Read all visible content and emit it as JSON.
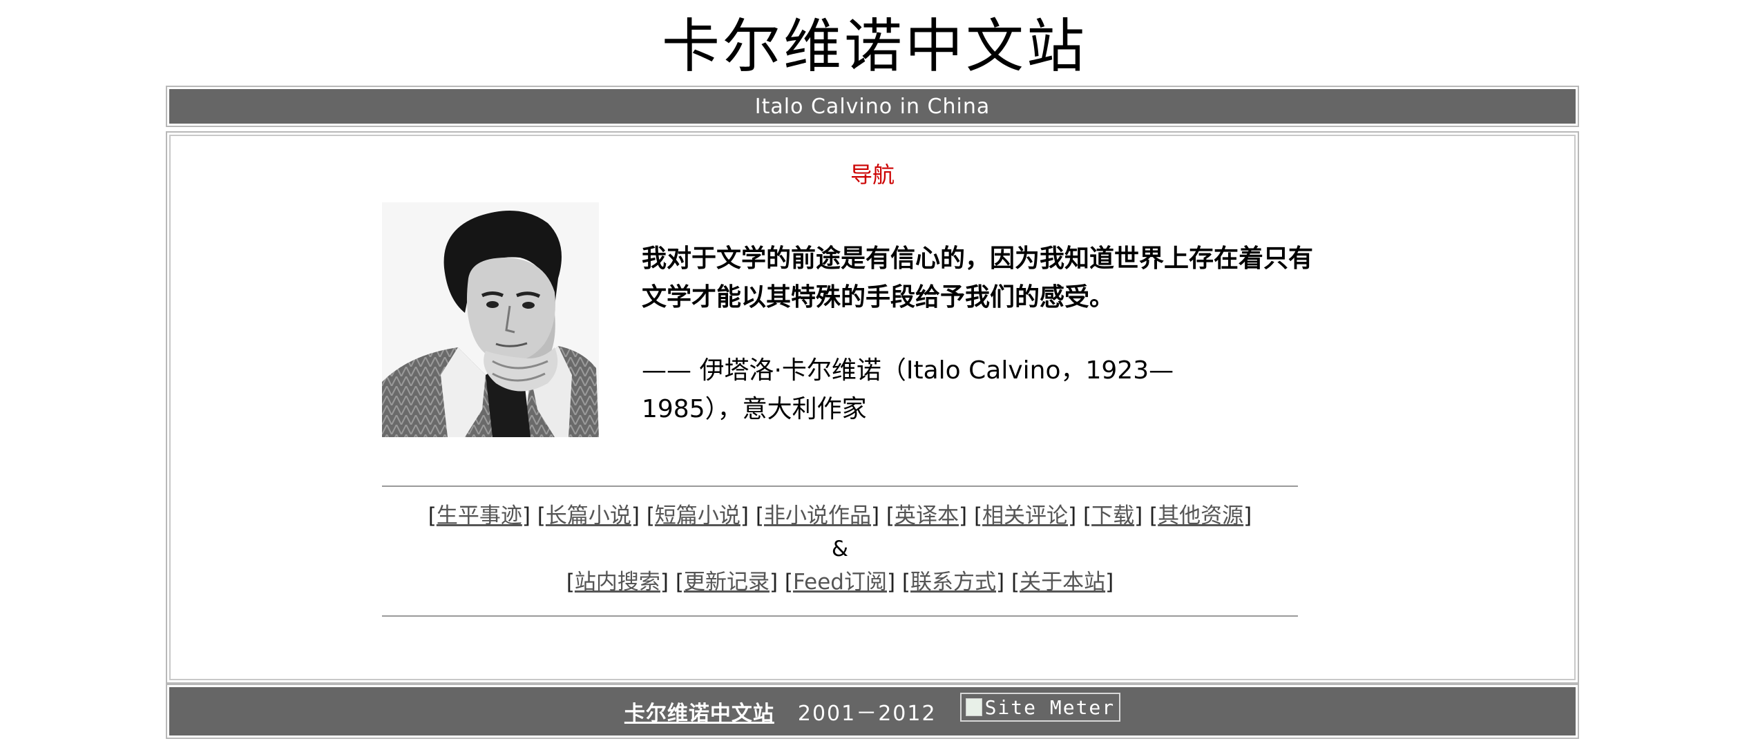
{
  "site": {
    "title": "卡尔维诺中文站",
    "subtitle": "Italo Calvino in China"
  },
  "main": {
    "nav_heading": "导航",
    "portrait_alt": "Italo Calvino portrait",
    "quote": "我对于文学的前途是有信心的，因为我知道世界上存在着只有文学才能以其特殊的手段给予我们的感受。",
    "attribution": "—— 伊塔洛·卡尔维诺（Italo Calvino，1923—1985），意大利作家",
    "links_row1": [
      "生平事迹",
      "长篇小说",
      "短篇小说",
      "非小说作品",
      "英译本",
      "相关评论",
      "下载",
      "其他资源"
    ],
    "ampersand": "&",
    "links_row2": [
      "站内搜索",
      "更新记录",
      "Feed订阅",
      "联系方式",
      "关于本站"
    ]
  },
  "footer": {
    "site_link": "卡尔维诺中文站",
    "years": "2001－2012",
    "sitemeter_alt": "Site Meter"
  },
  "colors": {
    "bar": "#666666",
    "nav_heading": "#cc0000",
    "link": "#555555"
  }
}
